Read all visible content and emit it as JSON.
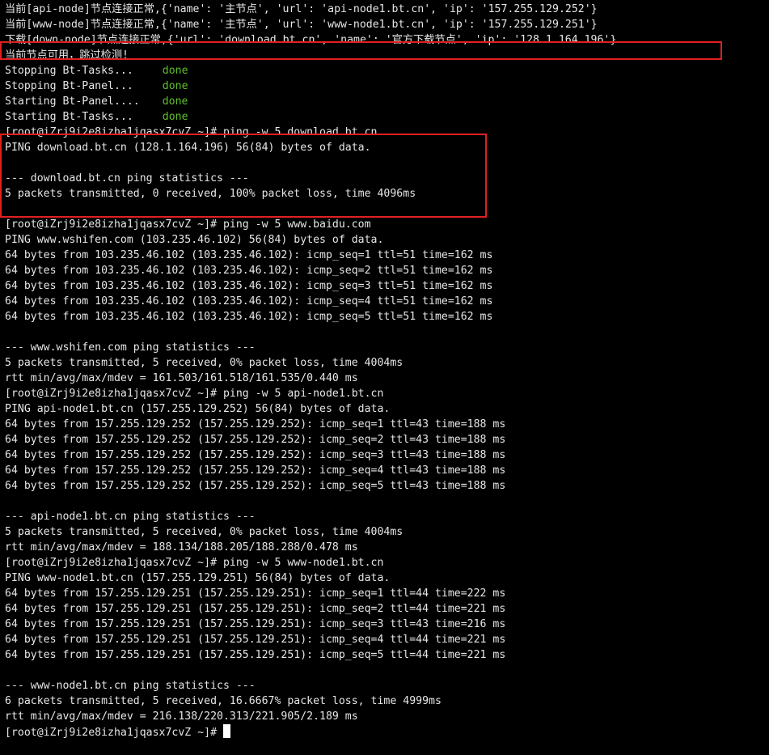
{
  "terminal": {
    "lines": {
      "l0": "当前[api-node]节点连接正常,{'name': '主节点', 'url': 'api-node1.bt.cn', 'ip': '157.255.129.252'}",
      "l1": "当前[www-node]节点连接正常,{'name': '主节点', 'url': 'www-node1.bt.cn', 'ip': '157.255.129.251'}",
      "l2": "下载[down-node]节点连接正常,{'url': 'download.bt.cn', 'name': '官方下载节点', 'ip': '128.1.164.196'}",
      "l3": "当前节点可用，跳过检测!",
      "l4": "Stopping Bt-Tasks...",
      "l5": "Stopping Bt-Panel...",
      "l6": "Starting Bt-Panel....",
      "l7": "Starting Bt-Tasks...",
      "l8": "[root@iZrj9i2e8izha1jqasx7cvZ ~]# ping -w 5 download.bt.cn",
      "l9": "PING download.bt.cn (128.1.164.196) 56(84) bytes of data.",
      "l10": "",
      "l11": "--- download.bt.cn ping statistics ---",
      "l12": "5 packets transmitted, 0 received, 100% packet loss, time 4096ms",
      "l13": "",
      "l14": "[root@iZrj9i2e8izha1jqasx7cvZ ~]# ping -w 5 www.baidu.com",
      "l15": "PING www.wshifen.com (103.235.46.102) 56(84) bytes of data.",
      "l16": "64 bytes from 103.235.46.102 (103.235.46.102): icmp_seq=1 ttl=51 time=162 ms",
      "l17": "64 bytes from 103.235.46.102 (103.235.46.102): icmp_seq=2 ttl=51 time=162 ms",
      "l18": "64 bytes from 103.235.46.102 (103.235.46.102): icmp_seq=3 ttl=51 time=162 ms",
      "l19": "64 bytes from 103.235.46.102 (103.235.46.102): icmp_seq=4 ttl=51 time=162 ms",
      "l20": "64 bytes from 103.235.46.102 (103.235.46.102): icmp_seq=5 ttl=51 time=162 ms",
      "l21": "",
      "l22": "--- www.wshifen.com ping statistics ---",
      "l23": "5 packets transmitted, 5 received, 0% packet loss, time 4004ms",
      "l24": "rtt min/avg/max/mdev = 161.503/161.518/161.535/0.440 ms",
      "l25": "[root@iZrj9i2e8izha1jqasx7cvZ ~]# ping -w 5 api-node1.bt.cn",
      "l26": "PING api-node1.bt.cn (157.255.129.252) 56(84) bytes of data.",
      "l27": "64 bytes from 157.255.129.252 (157.255.129.252): icmp_seq=1 ttl=43 time=188 ms",
      "l28": "64 bytes from 157.255.129.252 (157.255.129.252): icmp_seq=2 ttl=43 time=188 ms",
      "l29": "64 bytes from 157.255.129.252 (157.255.129.252): icmp_seq=3 ttl=43 time=188 ms",
      "l30": "64 bytes from 157.255.129.252 (157.255.129.252): icmp_seq=4 ttl=43 time=188 ms",
      "l31": "64 bytes from 157.255.129.252 (157.255.129.252): icmp_seq=5 ttl=43 time=188 ms",
      "l32": "",
      "l33": "--- api-node1.bt.cn ping statistics ---",
      "l34": "5 packets transmitted, 5 received, 0% packet loss, time 4004ms",
      "l35": "rtt min/avg/max/mdev = 188.134/188.205/188.288/0.478 ms",
      "l36": "[root@iZrj9i2e8izha1jqasx7cvZ ~]# ping -w 5 www-node1.bt.cn",
      "l37": "PING www-node1.bt.cn (157.255.129.251) 56(84) bytes of data.",
      "l38": "64 bytes from 157.255.129.251 (157.255.129.251): icmp_seq=1 ttl=44 time=222 ms",
      "l39": "64 bytes from 157.255.129.251 (157.255.129.251): icmp_seq=2 ttl=44 time=221 ms",
      "l40": "64 bytes from 157.255.129.251 (157.255.129.251): icmp_seq=3 ttl=43 time=216 ms",
      "l41": "64 bytes from 157.255.129.251 (157.255.129.251): icmp_seq=4 ttl=44 time=221 ms",
      "l42": "64 bytes from 157.255.129.251 (157.255.129.251): icmp_seq=5 ttl=44 time=221 ms",
      "l43": "",
      "l44": "--- www-node1.bt.cn ping statistics ---",
      "l45": "6 packets transmitted, 5 received, 16.6667% packet loss, time 4999ms",
      "l46": "rtt min/avg/max/mdev = 216.138/220.313/221.905/2.189 ms",
      "l47": "[root@iZrj9i2e8izha1jqasx7cvZ ~]# "
    },
    "done_label": "done"
  },
  "colors": {
    "background": "#000000",
    "foreground": "#e6e6e6",
    "done_green": "#5fbf2a",
    "annotation_red": "#e02020"
  }
}
